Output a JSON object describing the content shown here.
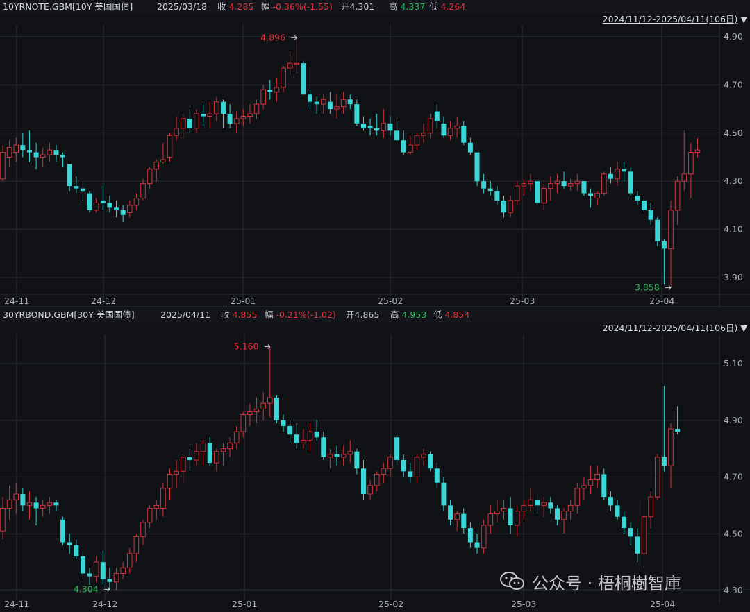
{
  "colors": {
    "up": "#d0333b",
    "down": "#3cd6d6",
    "high_marker": "#e8333d",
    "low_marker": "#26c05a",
    "grid": "#2a2d33",
    "axis_text": "#a9acb3",
    "background": "#101216"
  },
  "panels": [
    {
      "header": {
        "symbol": "10YRNOTE.GBM[10Y 美国国债]",
        "date": "2025/03/18",
        "close_label": "收",
        "close": "4.285",
        "change_label": "幅",
        "change": "-0.36%(-1.55)",
        "open_label": "开",
        "open": "4.301",
        "high_label": "高",
        "high": "4.337",
        "low_label": "低",
        "low": "4.264",
        "range": "2024/11/12-2025/04/11(106日)"
      },
      "markers": {
        "high": "4.896",
        "low": "3.858"
      }
    },
    {
      "header": {
        "symbol": "30YRBOND.GBM[30Y 美国国债]",
        "date": "2025/04/11",
        "close_label": "收",
        "close": "4.855",
        "change_label": "幅",
        "change": "-0.21%(-1.02)",
        "open_label": "开",
        "open": "4.865",
        "high_label": "高",
        "high": "4.953",
        "low_label": "低",
        "low": "4.854",
        "range": "2024/11/12-2025/04/11(106日)"
      },
      "markers": {
        "high": "5.160",
        "low": "4.304"
      }
    }
  ],
  "watermark": {
    "text": "公众号 · 梧桐樹智庫",
    "icon": "wechat-icon"
  },
  "chart_data": [
    {
      "type": "candlestick",
      "title": "10YRNOTE.GBM[10Y 美国国债]",
      "x_ticks": [
        "24-11",
        "24-12",
        "25-01",
        "25-02",
        "25-03",
        "25-04"
      ],
      "y_ticks": [
        "4.90",
        "4.70",
        "4.50",
        "4.30",
        "4.10",
        "3.90"
      ],
      "ylim": [
        3.85,
        4.96
      ],
      "grid": true,
      "annotations": {
        "high": 4.896,
        "low": 3.858
      },
      "ohlc": [
        [
          4.31,
          4.45,
          4.3,
          4.42
        ],
        [
          4.4,
          4.47,
          4.36,
          4.44
        ],
        [
          4.42,
          4.48,
          4.38,
          4.45
        ],
        [
          4.45,
          4.5,
          4.4,
          4.43
        ],
        [
          4.43,
          4.51,
          4.38,
          4.42
        ],
        [
          4.42,
          4.46,
          4.35,
          4.4
        ],
        [
          4.4,
          4.44,
          4.36,
          4.41
        ],
        [
          4.41,
          4.46,
          4.38,
          4.43
        ],
        [
          4.43,
          4.45,
          4.38,
          4.41
        ],
        [
          4.41,
          4.42,
          4.36,
          4.4
        ],
        [
          4.37,
          4.36,
          4.26,
          4.28
        ],
        [
          4.28,
          4.32,
          4.25,
          4.27
        ],
        [
          4.27,
          4.3,
          4.22,
          4.26
        ],
        [
          4.25,
          4.26,
          4.17,
          4.18
        ],
        [
          4.18,
          4.23,
          4.17,
          4.21
        ],
        [
          4.22,
          4.28,
          4.18,
          4.21
        ],
        [
          4.21,
          4.24,
          4.17,
          4.19
        ],
        [
          4.19,
          4.22,
          4.15,
          4.18
        ],
        [
          4.18,
          4.2,
          4.13,
          4.16
        ],
        [
          4.17,
          4.22,
          4.15,
          4.2
        ],
        [
          4.2,
          4.25,
          4.18,
          4.23
        ],
        [
          4.23,
          4.31,
          4.22,
          4.29
        ],
        [
          4.29,
          4.36,
          4.27,
          4.35
        ],
        [
          4.35,
          4.39,
          4.3,
          4.38
        ],
        [
          4.38,
          4.46,
          4.37,
          4.39
        ],
        [
          4.4,
          4.5,
          4.38,
          4.49
        ],
        [
          4.49,
          4.57,
          4.47,
          4.52
        ],
        [
          4.52,
          4.58,
          4.48,
          4.56
        ],
        [
          4.56,
          4.6,
          4.5,
          4.52
        ],
        [
          4.52,
          4.6,
          4.5,
          4.58
        ],
        [
          4.58,
          4.62,
          4.53,
          4.57
        ],
        [
          4.57,
          4.63,
          4.52,
          4.58
        ],
        [
          4.58,
          4.65,
          4.55,
          4.63
        ],
        [
          4.63,
          4.64,
          4.52,
          4.58
        ],
        [
          4.58,
          4.62,
          4.52,
          4.54
        ],
        [
          4.54,
          4.59,
          4.5,
          4.56
        ],
        [
          4.56,
          4.6,
          4.53,
          4.57
        ],
        [
          4.57,
          4.62,
          4.54,
          4.58
        ],
        [
          4.58,
          4.64,
          4.56,
          4.62
        ],
        [
          4.62,
          4.7,
          4.6,
          4.68
        ],
        [
          4.68,
          4.72,
          4.64,
          4.67
        ],
        [
          4.67,
          4.73,
          4.63,
          4.69
        ],
        [
          4.69,
          4.78,
          4.67,
          4.77
        ],
        [
          4.77,
          4.84,
          4.74,
          4.79
        ],
        [
          4.79,
          4.9,
          4.75,
          4.79
        ],
        [
          4.79,
          4.8,
          4.67,
          4.66
        ],
        [
          4.66,
          4.68,
          4.6,
          4.63
        ],
        [
          4.63,
          4.65,
          4.58,
          4.62
        ],
        [
          4.62,
          4.66,
          4.58,
          4.64
        ],
        [
          4.63,
          4.67,
          4.58,
          4.6
        ],
        [
          4.6,
          4.66,
          4.56,
          4.61
        ],
        [
          4.61,
          4.67,
          4.58,
          4.64
        ],
        [
          4.64,
          4.66,
          4.6,
          4.62
        ],
        [
          4.62,
          4.64,
          4.53,
          4.54
        ],
        [
          4.54,
          4.57,
          4.51,
          4.52
        ],
        [
          4.53,
          4.56,
          4.49,
          4.52
        ],
        [
          4.52,
          4.58,
          4.49,
          4.51
        ],
        [
          4.51,
          4.6,
          4.48,
          4.54
        ],
        [
          4.54,
          4.57,
          4.49,
          4.51
        ],
        [
          4.51,
          4.55,
          4.46,
          4.47
        ],
        [
          4.47,
          4.51,
          4.41,
          4.42
        ],
        [
          4.42,
          4.49,
          4.41,
          4.45
        ],
        [
          4.45,
          4.5,
          4.43,
          4.49
        ],
        [
          4.49,
          4.54,
          4.46,
          4.5
        ],
        [
          4.5,
          4.58,
          4.48,
          4.56
        ],
        [
          4.59,
          4.62,
          4.52,
          4.55
        ],
        [
          4.54,
          4.57,
          4.48,
          4.49
        ],
        [
          4.49,
          4.55,
          4.47,
          4.52
        ],
        [
          4.52,
          4.57,
          4.48,
          4.53
        ],
        [
          4.53,
          4.55,
          4.45,
          4.46
        ],
        [
          4.46,
          4.48,
          4.41,
          4.42
        ],
        [
          4.42,
          4.4,
          4.28,
          4.3
        ],
        [
          4.3,
          4.33,
          4.25,
          4.27
        ],
        [
          4.27,
          4.3,
          4.24,
          4.26
        ],
        [
          4.26,
          4.28,
          4.2,
          4.22
        ],
        [
          4.22,
          4.24,
          4.15,
          4.17
        ],
        [
          4.17,
          4.24,
          4.15,
          4.22
        ],
        [
          4.22,
          4.3,
          4.2,
          4.28
        ],
        [
          4.28,
          4.31,
          4.24,
          4.29
        ],
        [
          4.29,
          4.33,
          4.26,
          4.3
        ],
        [
          4.3,
          4.31,
          4.2,
          4.21
        ],
        [
          4.21,
          4.29,
          4.18,
          4.27
        ],
        [
          4.27,
          4.32,
          4.22,
          4.29
        ],
        [
          4.29,
          4.33,
          4.25,
          4.3
        ],
        [
          4.3,
          4.34,
          4.27,
          4.28
        ],
        [
          4.28,
          4.31,
          4.26,
          4.29
        ],
        [
          4.29,
          4.33,
          4.26,
          4.3
        ],
        [
          4.3,
          4.3,
          4.24,
          4.25
        ],
        [
          4.25,
          4.27,
          4.19,
          4.24
        ],
        [
          4.23,
          4.26,
          4.2,
          4.25
        ],
        [
          4.25,
          4.34,
          4.24,
          4.33
        ],
        [
          4.33,
          4.36,
          4.29,
          4.31
        ],
        [
          4.31,
          4.38,
          4.28,
          4.35
        ],
        [
          4.35,
          4.38,
          4.3,
          4.34
        ],
        [
          4.34,
          4.36,
          4.24,
          4.25
        ],
        [
          4.24,
          4.26,
          4.2,
          4.22
        ],
        [
          4.22,
          4.24,
          4.17,
          4.18
        ],
        [
          4.18,
          4.21,
          4.12,
          4.14
        ],
        [
          4.14,
          4.15,
          4.03,
          4.05
        ],
        [
          4.05,
          4.06,
          3.87,
          4.02
        ],
        [
          4.02,
          4.22,
          3.86,
          4.18
        ],
        [
          4.18,
          4.32,
          4.12,
          4.3
        ],
        [
          4.3,
          4.51,
          4.26,
          4.33
        ],
        [
          4.33,
          4.46,
          4.23,
          4.42
        ],
        [
          4.42,
          4.48,
          4.4,
          4.43
        ]
      ]
    },
    {
      "type": "candlestick",
      "title": "30YRBOND.GBM[30Y 美国国债]",
      "x_ticks": [
        "24-11",
        "24-12",
        "25-01",
        "25-02",
        "25-03",
        "25-04"
      ],
      "y_ticks": [
        "5.10",
        "4.90",
        "4.70",
        "4.50",
        "4.30"
      ],
      "ylim": [
        4.28,
        5.18
      ],
      "grid": true,
      "annotations": {
        "high": 5.16,
        "low": 4.304
      },
      "ohlc": [
        [
          4.51,
          4.63,
          4.48,
          4.59
        ],
        [
          4.59,
          4.67,
          4.55,
          4.62
        ],
        [
          4.62,
          4.68,
          4.57,
          4.64
        ],
        [
          4.64,
          4.66,
          4.58,
          4.6
        ],
        [
          4.6,
          4.65,
          4.55,
          4.61
        ],
        [
          4.61,
          4.63,
          4.53,
          4.59
        ],
        [
          4.59,
          4.62,
          4.56,
          4.6
        ],
        [
          4.6,
          4.63,
          4.57,
          4.61
        ],
        [
          4.61,
          4.62,
          4.58,
          4.6
        ],
        [
          4.55,
          4.56,
          4.46,
          4.47
        ],
        [
          4.47,
          4.5,
          4.43,
          4.46
        ],
        [
          4.46,
          4.48,
          4.41,
          4.42
        ],
        [
          4.42,
          4.44,
          4.34,
          4.36
        ],
        [
          4.36,
          4.38,
          4.32,
          4.35
        ],
        [
          4.35,
          4.42,
          4.33,
          4.4
        ],
        [
          4.4,
          4.44,
          4.32,
          4.34
        ],
        [
          4.34,
          4.38,
          4.3,
          4.33
        ],
        [
          4.33,
          4.38,
          4.3,
          4.36
        ],
        [
          4.36,
          4.4,
          4.34,
          4.38
        ],
        [
          4.38,
          4.45,
          4.36,
          4.43
        ],
        [
          4.43,
          4.5,
          4.4,
          4.49
        ],
        [
          4.49,
          4.55,
          4.46,
          4.54
        ],
        [
          4.54,
          4.6,
          4.52,
          4.59
        ],
        [
          4.59,
          4.62,
          4.55,
          4.6
        ],
        [
          4.59,
          4.68,
          4.56,
          4.66
        ],
        [
          4.66,
          4.73,
          4.62,
          4.71
        ],
        [
          4.71,
          4.76,
          4.66,
          4.72
        ],
        [
          4.72,
          4.78,
          4.68,
          4.77
        ],
        [
          4.77,
          4.8,
          4.72,
          4.76
        ],
        [
          4.76,
          4.82,
          4.74,
          4.79
        ],
        [
          4.79,
          4.83,
          4.74,
          4.82
        ],
        [
          4.82,
          4.84,
          4.74,
          4.75
        ],
        [
          4.75,
          4.8,
          4.72,
          4.79
        ],
        [
          4.79,
          4.82,
          4.74,
          4.8
        ],
        [
          4.8,
          4.84,
          4.77,
          4.82
        ],
        [
          4.82,
          4.88,
          4.8,
          4.86
        ],
        [
          4.86,
          4.93,
          4.84,
          4.92
        ],
        [
          4.92,
          4.96,
          4.88,
          4.93
        ],
        [
          4.93,
          4.98,
          4.89,
          4.94
        ],
        [
          4.94,
          5.0,
          4.9,
          4.96
        ],
        [
          4.96,
          5.16,
          4.91,
          4.98
        ],
        [
          4.98,
          4.99,
          4.89,
          4.9
        ],
        [
          4.9,
          4.92,
          4.86,
          4.88
        ],
        [
          4.88,
          4.9,
          4.82,
          4.85
        ],
        [
          4.85,
          4.89,
          4.8,
          4.82
        ],
        [
          4.82,
          4.87,
          4.8,
          4.83
        ],
        [
          4.83,
          4.89,
          4.79,
          4.86
        ],
        [
          4.86,
          4.9,
          4.83,
          4.84
        ],
        [
          4.84,
          4.86,
          4.76,
          4.77
        ],
        [
          4.77,
          4.8,
          4.73,
          4.78
        ],
        [
          4.78,
          4.81,
          4.74,
          4.77
        ],
        [
          4.77,
          4.81,
          4.74,
          4.78
        ],
        [
          4.78,
          4.83,
          4.75,
          4.79
        ],
        [
          4.79,
          4.8,
          4.71,
          4.73
        ],
        [
          4.73,
          4.76,
          4.62,
          4.64
        ],
        [
          4.64,
          4.69,
          4.62,
          4.67
        ],
        [
          4.67,
          4.72,
          4.65,
          4.71
        ],
        [
          4.71,
          4.75,
          4.68,
          4.73
        ],
        [
          4.73,
          4.78,
          4.7,
          4.77
        ],
        [
          4.84,
          4.85,
          4.74,
          4.76
        ],
        [
          4.76,
          4.78,
          4.7,
          4.72
        ],
        [
          4.72,
          4.75,
          4.68,
          4.7
        ],
        [
          4.7,
          4.78,
          4.68,
          4.77
        ],
        [
          4.77,
          4.8,
          4.74,
          4.78
        ],
        [
          4.78,
          4.79,
          4.72,
          4.73
        ],
        [
          4.73,
          4.75,
          4.66,
          4.68
        ],
        [
          4.68,
          4.7,
          4.58,
          4.6
        ],
        [
          4.6,
          4.62,
          4.53,
          4.55
        ],
        [
          4.55,
          4.58,
          4.51,
          4.57
        ],
        [
          4.57,
          4.59,
          4.5,
          4.52
        ],
        [
          4.52,
          4.54,
          4.45,
          4.47
        ],
        [
          4.47,
          4.5,
          4.43,
          4.45
        ],
        [
          4.45,
          4.55,
          4.43,
          4.53
        ],
        [
          4.53,
          4.6,
          4.5,
          4.57
        ],
        [
          4.57,
          4.62,
          4.54,
          4.58
        ],
        [
          4.58,
          4.62,
          4.55,
          4.59
        ],
        [
          4.59,
          4.63,
          4.5,
          4.53
        ],
        [
          4.53,
          4.6,
          4.49,
          4.58
        ],
        [
          4.58,
          4.62,
          4.55,
          4.6
        ],
        [
          4.6,
          4.66,
          4.58,
          4.62
        ],
        [
          4.62,
          4.64,
          4.57,
          4.6
        ],
        [
          4.6,
          4.63,
          4.56,
          4.61
        ],
        [
          4.61,
          4.63,
          4.57,
          4.59
        ],
        [
          4.59,
          4.6,
          4.53,
          4.55
        ],
        [
          4.55,
          4.59,
          4.5,
          4.58
        ],
        [
          4.58,
          4.62,
          4.55,
          4.6
        ],
        [
          4.6,
          4.68,
          4.57,
          4.66
        ],
        [
          4.66,
          4.7,
          4.62,
          4.67
        ],
        [
          4.67,
          4.74,
          4.64,
          4.69
        ],
        [
          4.69,
          4.74,
          4.66,
          4.71
        ],
        [
          4.71,
          4.73,
          4.62,
          4.63
        ],
        [
          4.63,
          4.65,
          4.58,
          4.6
        ],
        [
          4.6,
          4.62,
          4.55,
          4.56
        ],
        [
          4.56,
          4.58,
          4.5,
          4.52
        ],
        [
          4.52,
          4.54,
          4.46,
          4.49
        ],
        [
          4.49,
          4.52,
          4.4,
          4.43
        ],
        [
          4.43,
          4.62,
          4.38,
          4.56
        ],
        [
          4.56,
          4.65,
          4.52,
          4.63
        ],
        [
          4.63,
          4.78,
          4.62,
          4.77
        ],
        [
          4.77,
          5.02,
          4.72,
          4.74
        ],
        [
          4.74,
          4.89,
          4.66,
          4.87
        ],
        [
          4.87,
          4.95,
          4.85,
          4.86
        ]
      ]
    }
  ]
}
